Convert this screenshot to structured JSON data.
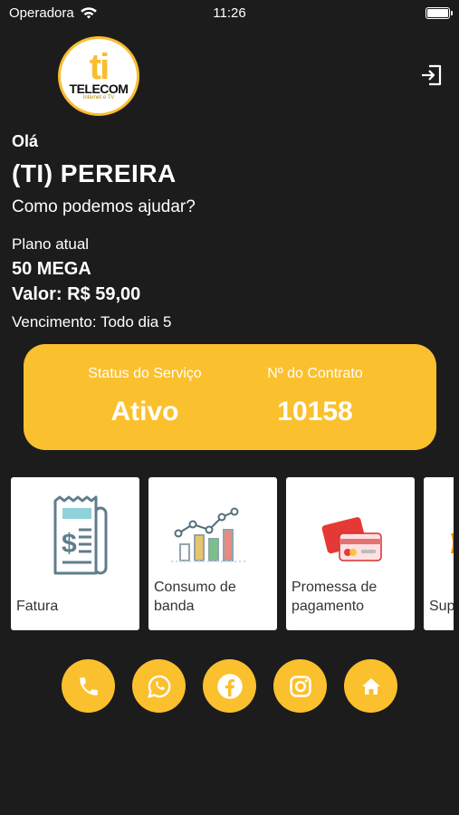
{
  "status_bar": {
    "carrier": "Operadora",
    "time": "11:26"
  },
  "logo": {
    "letters": "ti",
    "name": "TELECOM",
    "tagline": "Internet e TV"
  },
  "greeting": {
    "hello": "Olá",
    "name": "(TI) PEREIRA",
    "prompt": "Como podemos ajudar?"
  },
  "plan": {
    "label": "Plano atual",
    "name": "50 MEGA",
    "value": "Valor: R$ 59,00",
    "due": "Vencimento: Todo dia 5"
  },
  "status_card": {
    "service_label": "Status do Serviço",
    "service_value": "Ativo",
    "contract_label": "Nº do Contrato",
    "contract_value": "10158"
  },
  "tiles": [
    {
      "label": "Fatura",
      "icon": "invoice-icon"
    },
    {
      "label": "Consumo de banda",
      "icon": "bandwidth-chart-icon"
    },
    {
      "label": "Promessa de pagamento",
      "icon": "payment-cards-icon"
    },
    {
      "label": "Sup",
      "icon": "support-icon"
    }
  ],
  "social": [
    {
      "icon": "phone-icon"
    },
    {
      "icon": "whatsapp-icon"
    },
    {
      "icon": "facebook-icon"
    },
    {
      "icon": "instagram-icon"
    },
    {
      "icon": "home-icon"
    }
  ],
  "colors": {
    "accent": "#fbc02d",
    "background": "#1c1c1c"
  }
}
